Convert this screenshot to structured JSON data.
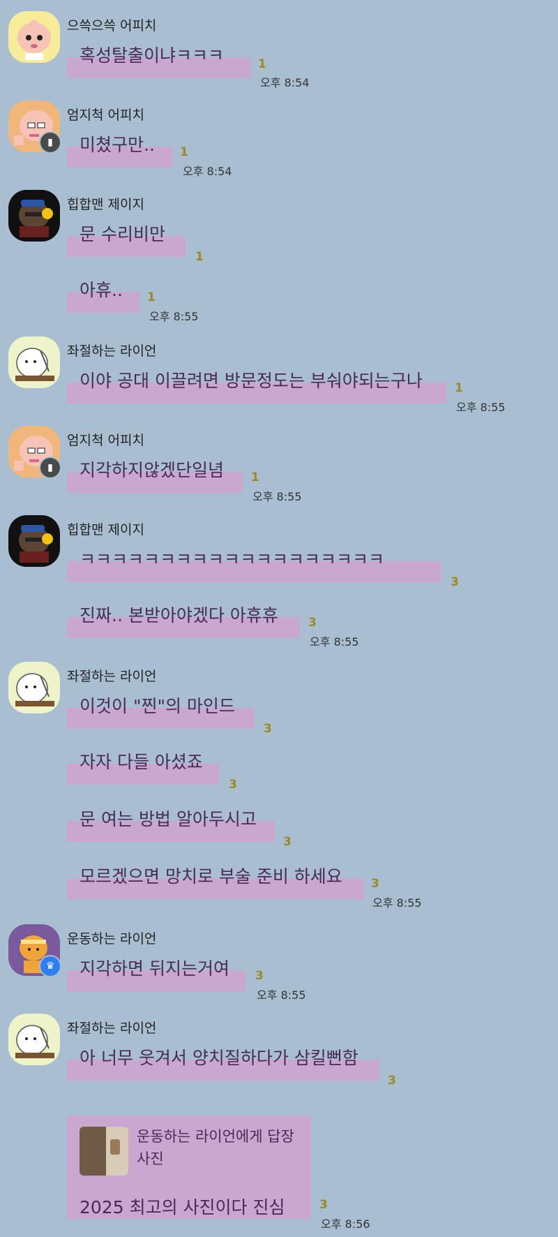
{
  "colors": {
    "background": "#a9bfd1",
    "bubble": "#c9a7cf",
    "unread": "#9b8a24"
  },
  "senders": {
    "s1": "으쓱으쓱 어피치",
    "s2": "엄지척 어피치",
    "s3": "힙합맨 제이지",
    "s4": "좌절하는 라이언",
    "s5": "엄지척 어피치",
    "s6": "힙합맨 제이지",
    "s7": "좌절하는 라이언",
    "s8": "운동하는 라이언",
    "s9": "좌절하는 라이언"
  },
  "messages": {
    "m1": {
      "text": "혹성탈출이냐ㅋㅋㅋ",
      "unread": "1",
      "time": "오후 8:54"
    },
    "m2": {
      "text": "미쳤구만..",
      "unread": "1",
      "time": "오후 8:54"
    },
    "m3": {
      "text": "문 수리비만",
      "unread": "1"
    },
    "m4": {
      "text": "아휴..",
      "unread": "1",
      "time": "오후 8:55"
    },
    "m5": {
      "text": "이야 공대 이끌려면 방문정도는 부숴야되는구나",
      "unread": "1",
      "time": "오후 8:55"
    },
    "m6": {
      "text": "지각하지않겠단일념",
      "unread": "1",
      "time": "오후 8:55"
    },
    "m7": {
      "text": "ㅋㅋㅋㅋㅋㅋㅋㅋㅋㅋㅋㅋㅋㅋㅋㅋㅋㅋㅋ",
      "unread": "3"
    },
    "m8": {
      "text": "진짜.. 본받아야겠다 아휴휴",
      "unread": "3",
      "time": "오후 8:55"
    },
    "m9": {
      "text": "이것이 \"찐\"의 마인드",
      "unread": "3"
    },
    "m10": {
      "text": "자자 다들 아셨죠",
      "unread": "3"
    },
    "m11": {
      "text": "문 여는 방법 알아두시고",
      "unread": "3"
    },
    "m12": {
      "text": "모르겠으면 망치로 부술 준비 하세요",
      "unread": "3",
      "time": "오후 8:55"
    },
    "m13": {
      "text": "지각하면 뒤지는거여",
      "unread": "3",
      "time": "오후 8:55"
    },
    "m14": {
      "text": "아 너무 웃겨서 양치질하다가 삼킬뻔함",
      "unread": "3"
    },
    "m15": {
      "reply_to": "운동하는 라이언에게 답장",
      "reply_type": "사진",
      "text": "2025 최고의 사진이다 진심",
      "unread": "3",
      "time": "오후 8:56"
    }
  },
  "icons": {
    "apeach_avatar": "apeach-icon",
    "jayg_avatar": "jayg-icon",
    "ryan_avatar": "ryan-icon",
    "badge_pin": "pin-icon",
    "badge_crown": "crown-icon"
  }
}
